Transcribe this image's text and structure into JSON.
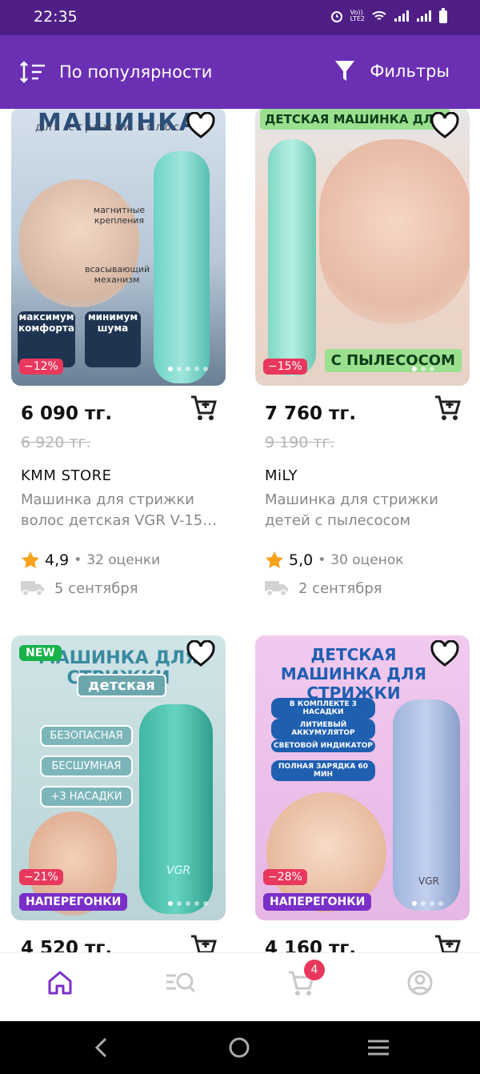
{
  "status_bar": {
    "time": "22:35",
    "icons": [
      "alarm-icon",
      "volte-icon",
      "wifi-icon",
      "signal-icon",
      "signal-icon",
      "battery-icon"
    ],
    "volte_text": "Vo))\nLTE2"
  },
  "toolbar": {
    "sort_label": "По популярности",
    "filter_label": "Фильтры",
    "accent": "#6b2fb4"
  },
  "products": [
    {
      "price": "6 090 тг.",
      "old_price": "6 920 тг.",
      "discount": "−12%",
      "seller": "KMM STORE",
      "title": "Машинка для стрижки волос детская VGR V-15…",
      "rating": "4,9",
      "reviews": "32 оценки",
      "delivery": "5 сентября",
      "image": {
        "title": "МАШИНКА",
        "subtitle": "для стрижки волос",
        "tiles": [
          "магнитные крепления",
          "всасывающий механизм",
          "максимум комфорта",
          "минимум шума"
        ]
      }
    },
    {
      "price": "7 760 тг.",
      "old_price": "9 190 тг.",
      "discount": "−15%",
      "seller": "MiLY",
      "title": "Машинка для стрижки детей с пылесосом",
      "rating": "5,0",
      "reviews": "30 оценок",
      "delivery": "2 сентября",
      "image": {
        "title": "ДЕТСКАЯ МАШИНКА ДЛЯ СТРИЖ",
        "footer": "С ПЫЛЕСОСОМ"
      }
    },
    {
      "price": "4 520 тг.",
      "new_badge": "NEW",
      "discount": "−21%",
      "promo": "НАПЕРЕГОНКИ",
      "image": {
        "title": "МАШИНКА ДЛЯ СТРИЖКИ",
        "subtitle": "детская",
        "tiles": [
          "БЕЗОПАСНАЯ",
          "БЕСШУМНАЯ",
          "+3 НАСАДКИ"
        ],
        "brand": "VGR"
      }
    },
    {
      "price": "4 160 тг.",
      "discount": "−28%",
      "promo": "НАПЕРЕГОНКИ",
      "image": {
        "title": "ДЕТСКАЯ МАШИНКА ДЛЯ СТРИЖКИ",
        "tiles": [
          "В КОМПЛЕКТЕ 3 НАСАДКИ",
          "ЛИТИЕВЫЙ АККУМУЛЯТОР",
          "СВЕТОВОЙ ИНДИКАТОР",
          "ПОЛНАЯ ЗАРЯДКА 60 МИН"
        ],
        "brand": "VGR"
      }
    }
  ],
  "bottom_nav": {
    "items": [
      "home-icon",
      "catalog-icon",
      "cart-icon",
      "profile-icon"
    ],
    "cart_badge": "4",
    "active": "home-icon"
  },
  "colors": {
    "status_bar": "#4f1f86",
    "discount": "#e8385d",
    "new": "#17b24a",
    "promo": "#7a2fc8",
    "star": "#f7a21b"
  }
}
